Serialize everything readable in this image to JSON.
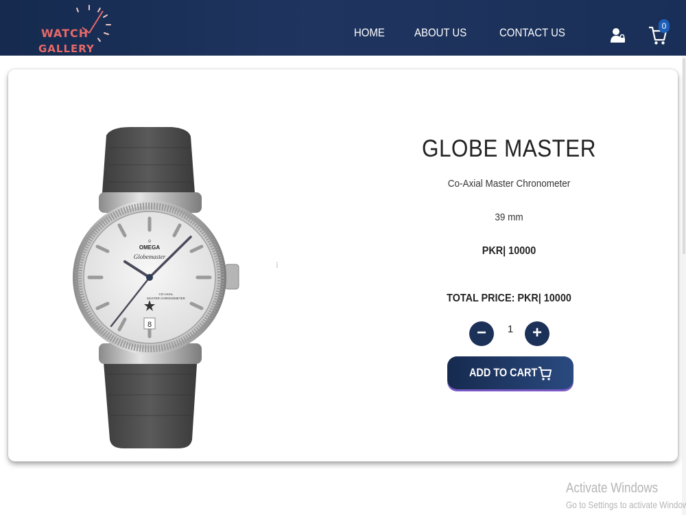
{
  "header": {
    "logo": {
      "line1": "WATCH",
      "line2": "GALLERY"
    },
    "nav": [
      "HOME",
      "ABOUT US",
      "CONTACT US"
    ],
    "cart_count": "0",
    "icons": {
      "user": "user-lock-icon",
      "cart": "cart-icon"
    }
  },
  "product": {
    "title": "GLOBE MASTER",
    "subtitle": "Co-Axial Master Chronometer",
    "size": "39 mm",
    "price": "PKR| 10000",
    "total_price": "TOTAL PRICE: PKR| 10000",
    "quantity": "1",
    "minus_label": "−",
    "plus_label": "+",
    "add_to_cart": "ADD TO CART",
    "watch_brand": "OMEGA",
    "watch_model": "Globemaster",
    "dial_line1": "CO-AXIAL",
    "dial_line2": "MASTER CHRONOMETER",
    "date": "8"
  },
  "colors": {
    "header": "#1a2f57",
    "logo": "#e86a6a",
    "button": "#1c3158",
    "accent": "#7b5ac8"
  },
  "watermark": {
    "line1": "Activate Windows",
    "line2": "Go to Settings to activate Windows."
  }
}
